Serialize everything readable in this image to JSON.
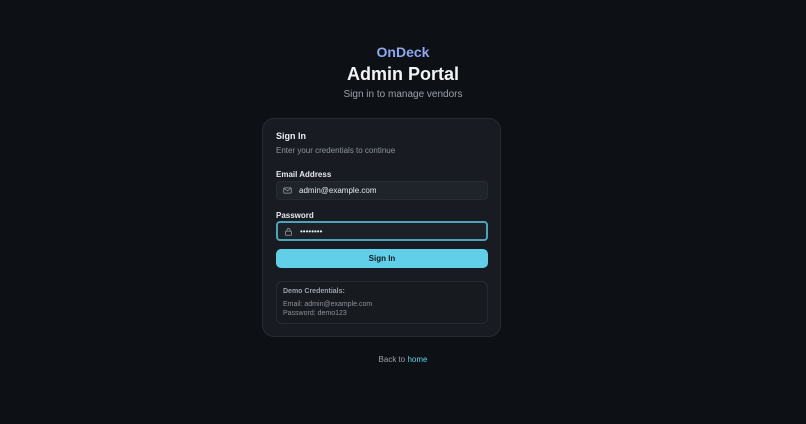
{
  "header": {
    "brand": "OnDeck",
    "title": "Admin Portal",
    "subtitle": "Sign in to manage vendors"
  },
  "card": {
    "title": "Sign In",
    "description": "Enter your credentials to continue",
    "email": {
      "label": "Email Address",
      "value": "admin@example.com",
      "icon": "mail-icon"
    },
    "password": {
      "label": "Password",
      "value": "demo1234",
      "icon": "lock-icon"
    },
    "submit_label": "Sign In",
    "demo": {
      "title": "Demo Credentials:",
      "email_line": "Email: admin@example.com",
      "password_line": "Password: demo123"
    }
  },
  "footer": {
    "text": "Back to",
    "link": "home"
  },
  "colors": {
    "accent": "#62cfe9",
    "background": "#0d1014",
    "card": "#181c22"
  }
}
